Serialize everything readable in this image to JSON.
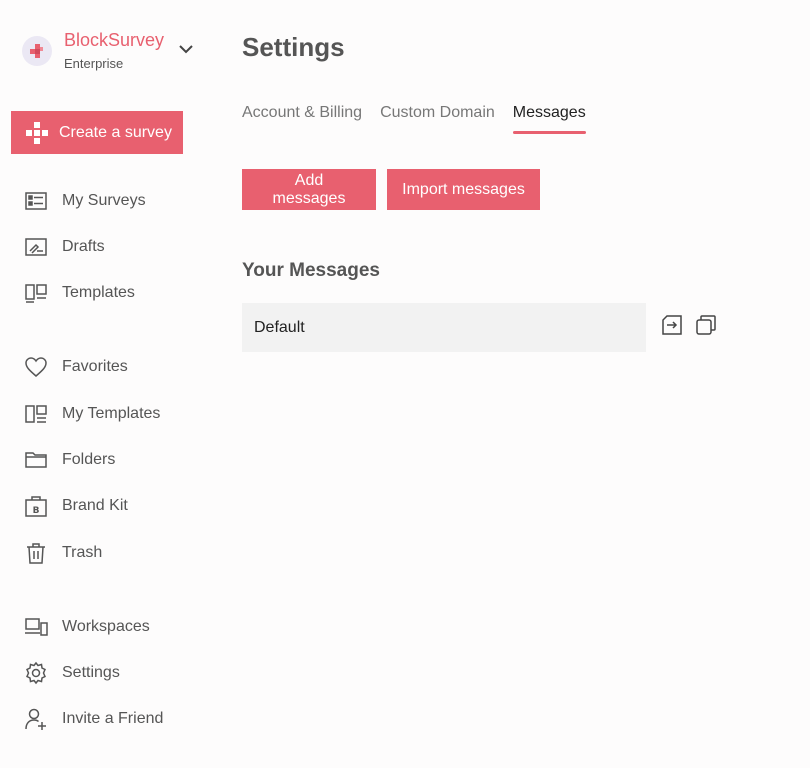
{
  "brand": {
    "name": "BlockSurvey",
    "plan": "Enterprise",
    "accent_color": "#e8606f"
  },
  "sidebar": {
    "create_label": "Create a survey",
    "items": [
      {
        "label": "My Surveys",
        "icon": "list-icon"
      },
      {
        "label": "Drafts",
        "icon": "draft-icon"
      },
      {
        "label": "Templates",
        "icon": "templates-icon"
      },
      {
        "label": "Favorites",
        "icon": "heart-icon"
      },
      {
        "label": "My Templates",
        "icon": "my-templates-icon"
      },
      {
        "label": "Folders",
        "icon": "folder-icon"
      },
      {
        "label": "Brand Kit",
        "icon": "brand-kit-icon"
      },
      {
        "label": "Trash",
        "icon": "trash-icon"
      },
      {
        "label": "Workspaces",
        "icon": "workspaces-icon"
      },
      {
        "label": "Settings",
        "icon": "gear-icon"
      },
      {
        "label": "Invite a Friend",
        "icon": "add-user-icon"
      }
    ]
  },
  "main": {
    "title": "Settings",
    "tabs": [
      {
        "label": "Account & Billing",
        "active": false
      },
      {
        "label": "Custom Domain",
        "active": false
      },
      {
        "label": "Messages",
        "active": true
      }
    ],
    "add_label": "Add messages",
    "import_label": "Import messages",
    "section_title": "Your Messages",
    "messages": [
      {
        "name": "Default",
        "actions": [
          "export-icon",
          "copy-icon"
        ]
      }
    ]
  }
}
